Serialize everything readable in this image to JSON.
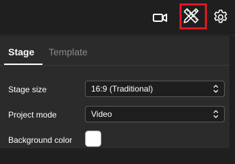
{
  "header": {
    "icons": [
      "camera-icon",
      "pen-ruler-tool-icon",
      "gear-icon"
    ]
  },
  "tabs": [
    {
      "label": "Stage",
      "active": true
    },
    {
      "label": "Template",
      "active": false
    }
  ],
  "stage_settings": {
    "stage_size": {
      "label": "Stage size",
      "value": "16:9 (Traditional)"
    },
    "project_mode": {
      "label": "Project mode",
      "value": "Video"
    },
    "background_color": {
      "label": "Background color",
      "value": "#ffffff"
    }
  },
  "colors": {
    "highlight": "#e0181f",
    "panel_bg": "#2b2b2b",
    "header_bg": "#1f1f1f"
  }
}
